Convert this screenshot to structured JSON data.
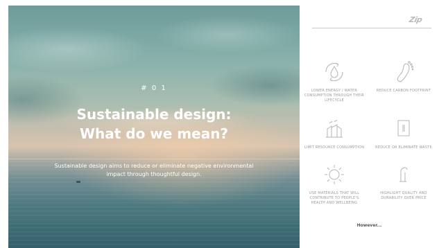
{
  "hero": {
    "number": "# 0 1",
    "title_line1": "Sustainable design:",
    "title_line2": "What do we mean?",
    "description": "Sustainable design aims to reduce or eliminate negative environmental impact through thoughtful design."
  },
  "brand": {
    "logo_text": "Zip"
  },
  "features": [
    {
      "icon": "water-drop-cycle-icon",
      "label": "LOWER ENERGY / WATER CONSUMPTION THROUGH THEIR LIFECYCLE"
    },
    {
      "icon": "footprint-icon",
      "label": "REDUCE CARBON FOOTPRINT"
    },
    {
      "icon": "factory-icon",
      "label": "LIMIT RESOURCE CONSUMPTION"
    },
    {
      "icon": "bin-icon",
      "label": "REDUCE OR ELIMINATE WASTE"
    },
    {
      "icon": "sun-icon",
      "label": "USE MATERIALS THAT WILL CONTRIBUTE TO PEOPLE'S HEALTH AND WELLBEING"
    },
    {
      "icon": "tap-icon",
      "label": "HIGHLIGHT QUALITY AND DURABILITY OVER PRICE"
    }
  ],
  "footer": {
    "however": "However..."
  },
  "colors": {
    "icon_stroke": "#b5b5b5",
    "label_text": "#9a9a9a",
    "hero_text": "#ffffff"
  }
}
